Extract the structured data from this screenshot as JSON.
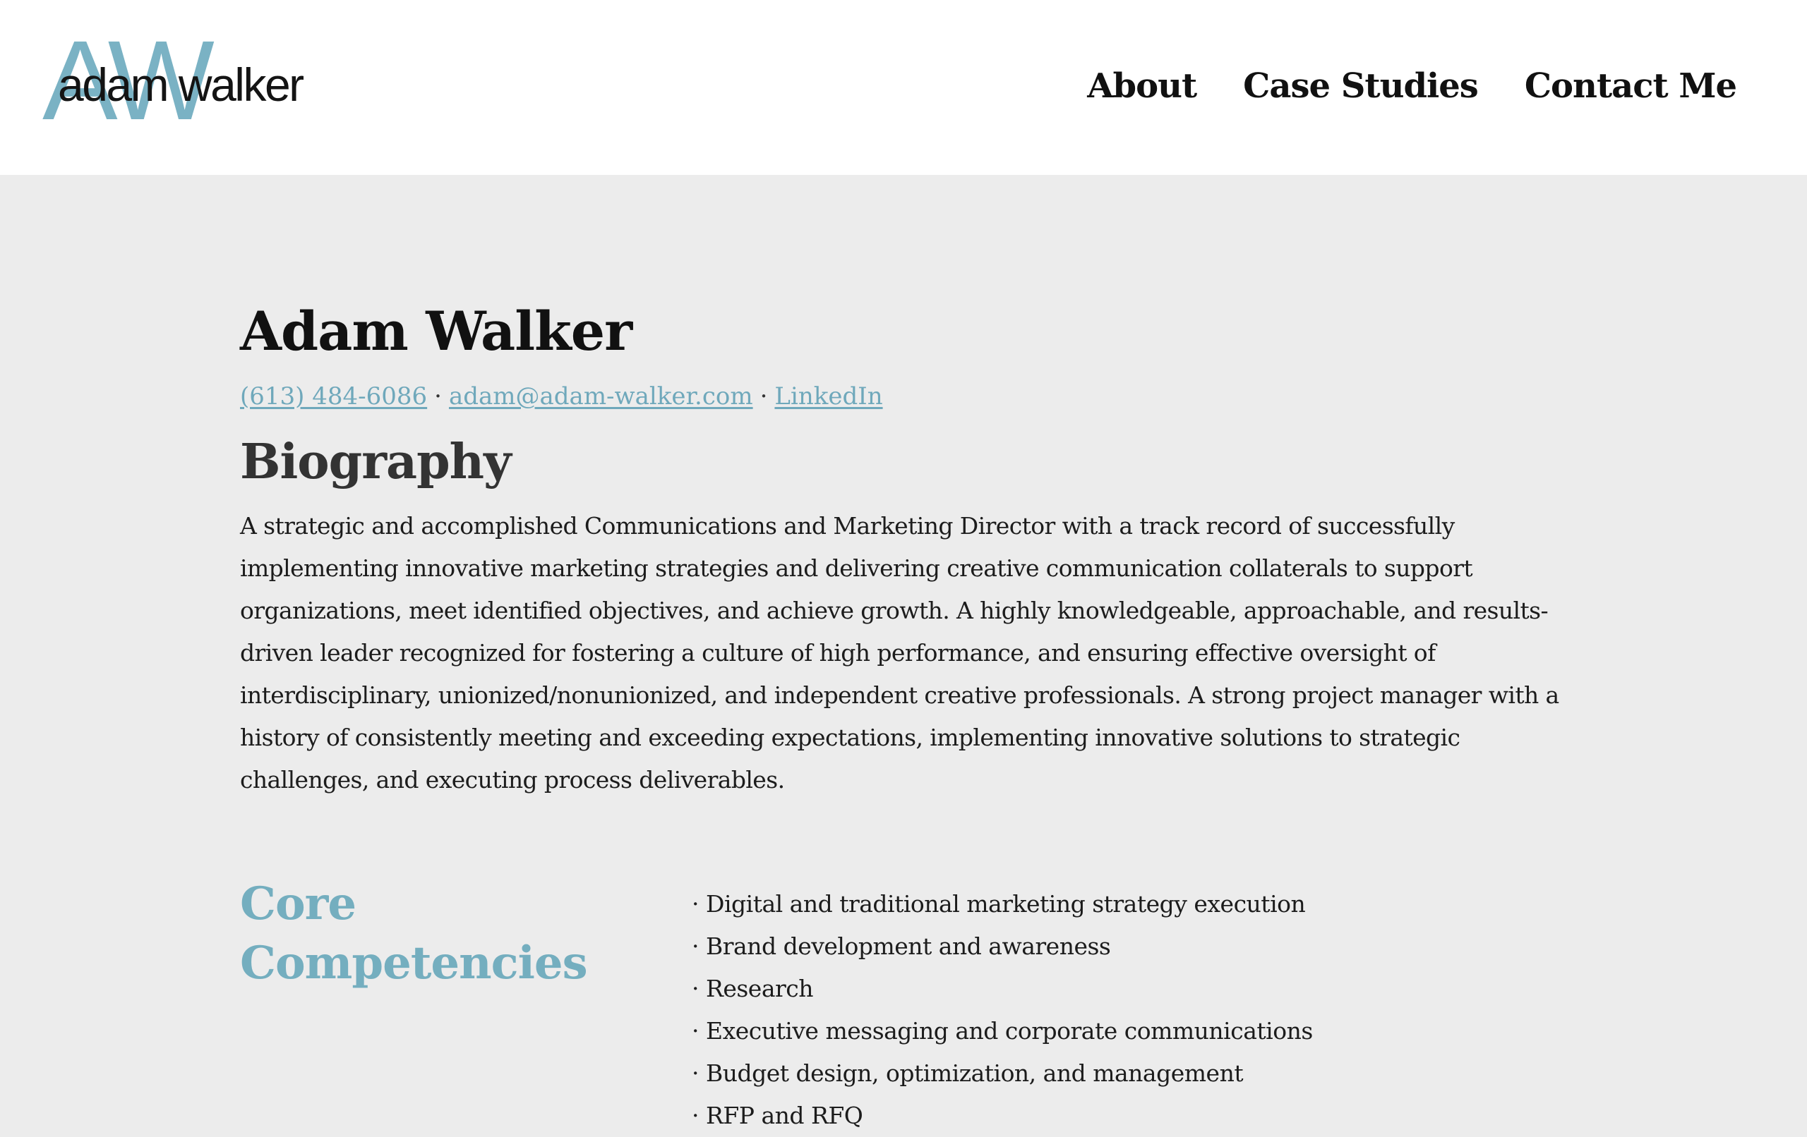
{
  "header": {
    "logo": {
      "monogram": "AW",
      "wordmark": "adam walker"
    },
    "nav": [
      {
        "label": "About"
      },
      {
        "label": "Case Studies"
      },
      {
        "label": "Contact Me"
      }
    ]
  },
  "profile": {
    "name": "Adam Walker",
    "phone": "(613) 484-6086",
    "email": "adam@adam-walker.com",
    "linkedin": "LinkedIn",
    "separator": "·"
  },
  "biography": {
    "title": "Biography",
    "text": "A strategic and accomplished Communications and Marketing Director with a track record of successfully implementing innovative marketing strategies and delivering creative communication collaterals to support organizations, meet identified objectives, and achieve growth. A highly knowledgeable, approachable, and results-driven leader recognized for fostering a culture of high performance, and ensuring effective oversight of interdisciplinary, unionized/nonunionized, and independent creative professionals. A strong project manager with a history of consistently meeting and exceeding expectations, implementing innovative solutions to strategic challenges, and executing process deliverables."
  },
  "competencies": {
    "title": "Core Competencies",
    "bullet": "·",
    "items": [
      "Digital and traditional marketing strategy execution",
      "Brand development and awareness",
      "Research",
      "Executive messaging and corporate communications",
      "Budget design, optimization, and management",
      "RFP and RFQ"
    ]
  },
  "colors": {
    "accent": "#74aebf",
    "header_bg": "#ffffff",
    "page_bg": "#ececec"
  }
}
